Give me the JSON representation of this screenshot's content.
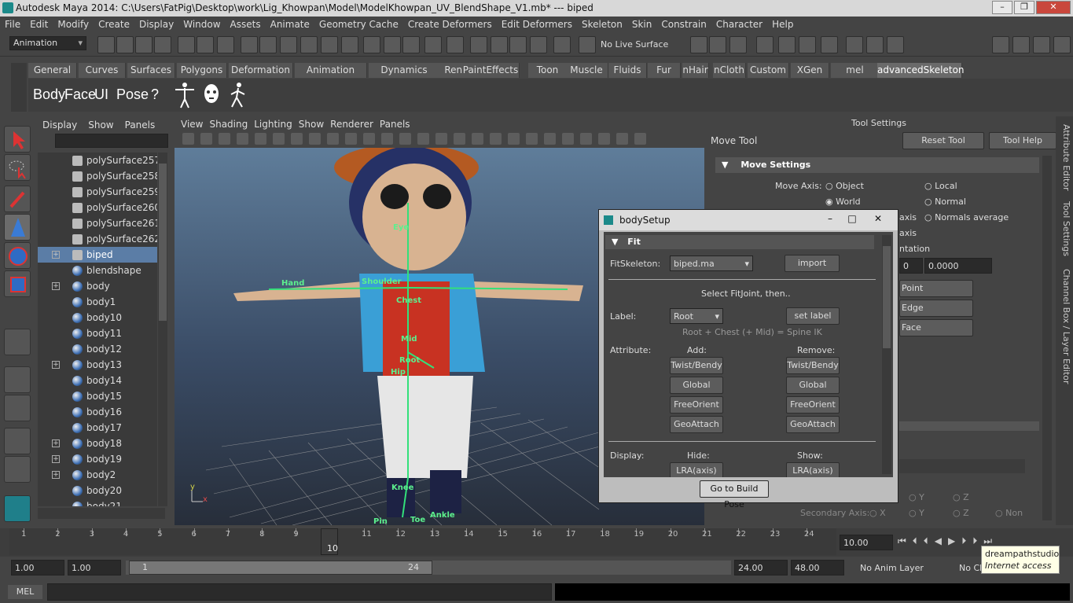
{
  "window": {
    "title": "Autodesk Maya 2014: C:\\Users\\FatPig\\Desktop\\work\\Lig_Khowpan\\Model\\ModelKhowpan_UV_BlendShape_V1.mb*   ---   biped"
  },
  "menu": [
    "File",
    "Edit",
    "Modify",
    "Create",
    "Display",
    "Window",
    "Assets",
    "Animate",
    "Geometry Cache",
    "Create Deformers",
    "Edit Deformers",
    "Skeleton",
    "Skin",
    "Constrain",
    "Character",
    "Help"
  ],
  "status": {
    "mode": "Animation",
    "live_surface": "No Live Surface"
  },
  "shelf_tabs": [
    "General",
    "Curves",
    "Surfaces",
    "Polygons",
    "Deformation",
    "Animation",
    "Dynamics",
    "Rendering",
    "PaintEffects",
    "Toon",
    "Muscle",
    "Fluids",
    "Fur",
    "nHair",
    "nCloth",
    "Custom",
    "XGen",
    "mel",
    "advancedSkeleton"
  ],
  "shelf": {
    "items": [
      "Body",
      "Face",
      "UI",
      "Pose",
      "?"
    ]
  },
  "outliner": {
    "menu": [
      "Display",
      "Show",
      "Panels"
    ],
    "rows": [
      {
        "label": "polySurface257",
        "type": "mesh",
        "exp": false,
        "sel": false
      },
      {
        "label": "polySurface258",
        "type": "mesh",
        "exp": false,
        "sel": false
      },
      {
        "label": "polySurface259",
        "type": "mesh",
        "exp": false,
        "sel": false
      },
      {
        "label": "polySurface260",
        "type": "mesh",
        "exp": false,
        "sel": false
      },
      {
        "label": "polySurface261",
        "type": "mesh",
        "exp": false,
        "sel": false
      },
      {
        "label": "polySurface262",
        "type": "mesh",
        "exp": false,
        "sel": false
      },
      {
        "label": "biped",
        "type": "joint",
        "exp": true,
        "sel": true
      },
      {
        "label": "blendshape",
        "type": "node",
        "exp": false,
        "sel": false
      },
      {
        "label": "body",
        "type": "node",
        "exp": true,
        "sel": false
      },
      {
        "label": "body1",
        "type": "node",
        "exp": false,
        "sel": false
      },
      {
        "label": "body10",
        "type": "node",
        "exp": false,
        "sel": false
      },
      {
        "label": "body11",
        "type": "node",
        "exp": false,
        "sel": false
      },
      {
        "label": "body12",
        "type": "node",
        "exp": false,
        "sel": false
      },
      {
        "label": "body13",
        "type": "node",
        "exp": true,
        "sel": false
      },
      {
        "label": "body14",
        "type": "node",
        "exp": false,
        "sel": false
      },
      {
        "label": "body15",
        "type": "node",
        "exp": false,
        "sel": false
      },
      {
        "label": "body16",
        "type": "node",
        "exp": false,
        "sel": false
      },
      {
        "label": "body17",
        "type": "node",
        "exp": false,
        "sel": false
      },
      {
        "label": "body18",
        "type": "node",
        "exp": true,
        "sel": false
      },
      {
        "label": "body19",
        "type": "node",
        "exp": true,
        "sel": false
      },
      {
        "label": "body2",
        "type": "node",
        "exp": true,
        "sel": false
      },
      {
        "label": "body20",
        "type": "node",
        "exp": false,
        "sel": false
      },
      {
        "label": "body21",
        "type": "node",
        "exp": false,
        "sel": false
      }
    ]
  },
  "viewport": {
    "menu": [
      "View",
      "Shading",
      "Lighting",
      "Show",
      "Renderer",
      "Panels"
    ],
    "joint_labels": [
      "Eye",
      "Hand",
      "Shoulder",
      "Chest",
      "Mid",
      "Root",
      "Hip",
      "Knee",
      "Toe",
      "Pin",
      "Ankle"
    ],
    "axis": {
      "x": "x",
      "y": "y"
    }
  },
  "tool_settings": {
    "header": "Tool Settings",
    "tool": "Move Tool",
    "reset": "Reset Tool",
    "help": "Tool Help",
    "section": "Move Settings",
    "move_axis_label": "Move Axis:",
    "axes": [
      "Object",
      "Local",
      "World",
      "Normal",
      "axis",
      "Normals average"
    ],
    "partial": [
      "axis",
      "ntation"
    ],
    "val0": "0",
    "val1": "0.0000",
    "buttons": [
      "Point",
      "Edge",
      "Face"
    ],
    "secondary_axis": "Secondary Axis:",
    "sec_opts": [
      "X",
      "Y",
      "Z",
      "Non"
    ],
    "y": "Y",
    "z": "Z"
  },
  "right_tabs": [
    "Attribute Editor",
    "Tool Settings",
    "Channel Box / Layer Editor"
  ],
  "dialog": {
    "title": "bodySetup",
    "section": "Fit",
    "fit_label": "FitSkeleton:",
    "fit_value": "biped.ma",
    "import": "import",
    "select_msg": "Select FitJoint, then..",
    "label_label": "Label:",
    "label_value": "Root",
    "set_label": "set label",
    "hint": "Root + Chest (+ Mid) = Spine IK",
    "attribute_label": "Attribute:",
    "add": "Add:",
    "remove": "Remove:",
    "attr_buttons": [
      "Twist/Bendy",
      "Global",
      "FreeOrient",
      "GeoAttach"
    ],
    "display_label": "Display:",
    "hide": "Hide:",
    "show": "Show:",
    "lra": "LRA(axis)",
    "go": "Go to Build Pose"
  },
  "timeline": {
    "ticks": [
      "1",
      "2",
      "3",
      "4",
      "5",
      "6",
      "7",
      "8",
      "9",
      "10",
      "11",
      "12",
      "13",
      "14",
      "15",
      "16",
      "17",
      "18",
      "19",
      "20",
      "21",
      "22",
      "23",
      "24"
    ],
    "current": "10",
    "current_field": "10.00"
  },
  "range": {
    "start": "1.00",
    "start2": "1.00",
    "slider_start": "1",
    "slider_end": "24",
    "end": "24.00",
    "end2": "48.00",
    "anim_layer": "No Anim Layer",
    "char": "No Ch"
  },
  "cmd": {
    "label": "MEL"
  },
  "tooltip": {
    "line1": "dreampathstudio",
    "line2": "Internet access"
  }
}
